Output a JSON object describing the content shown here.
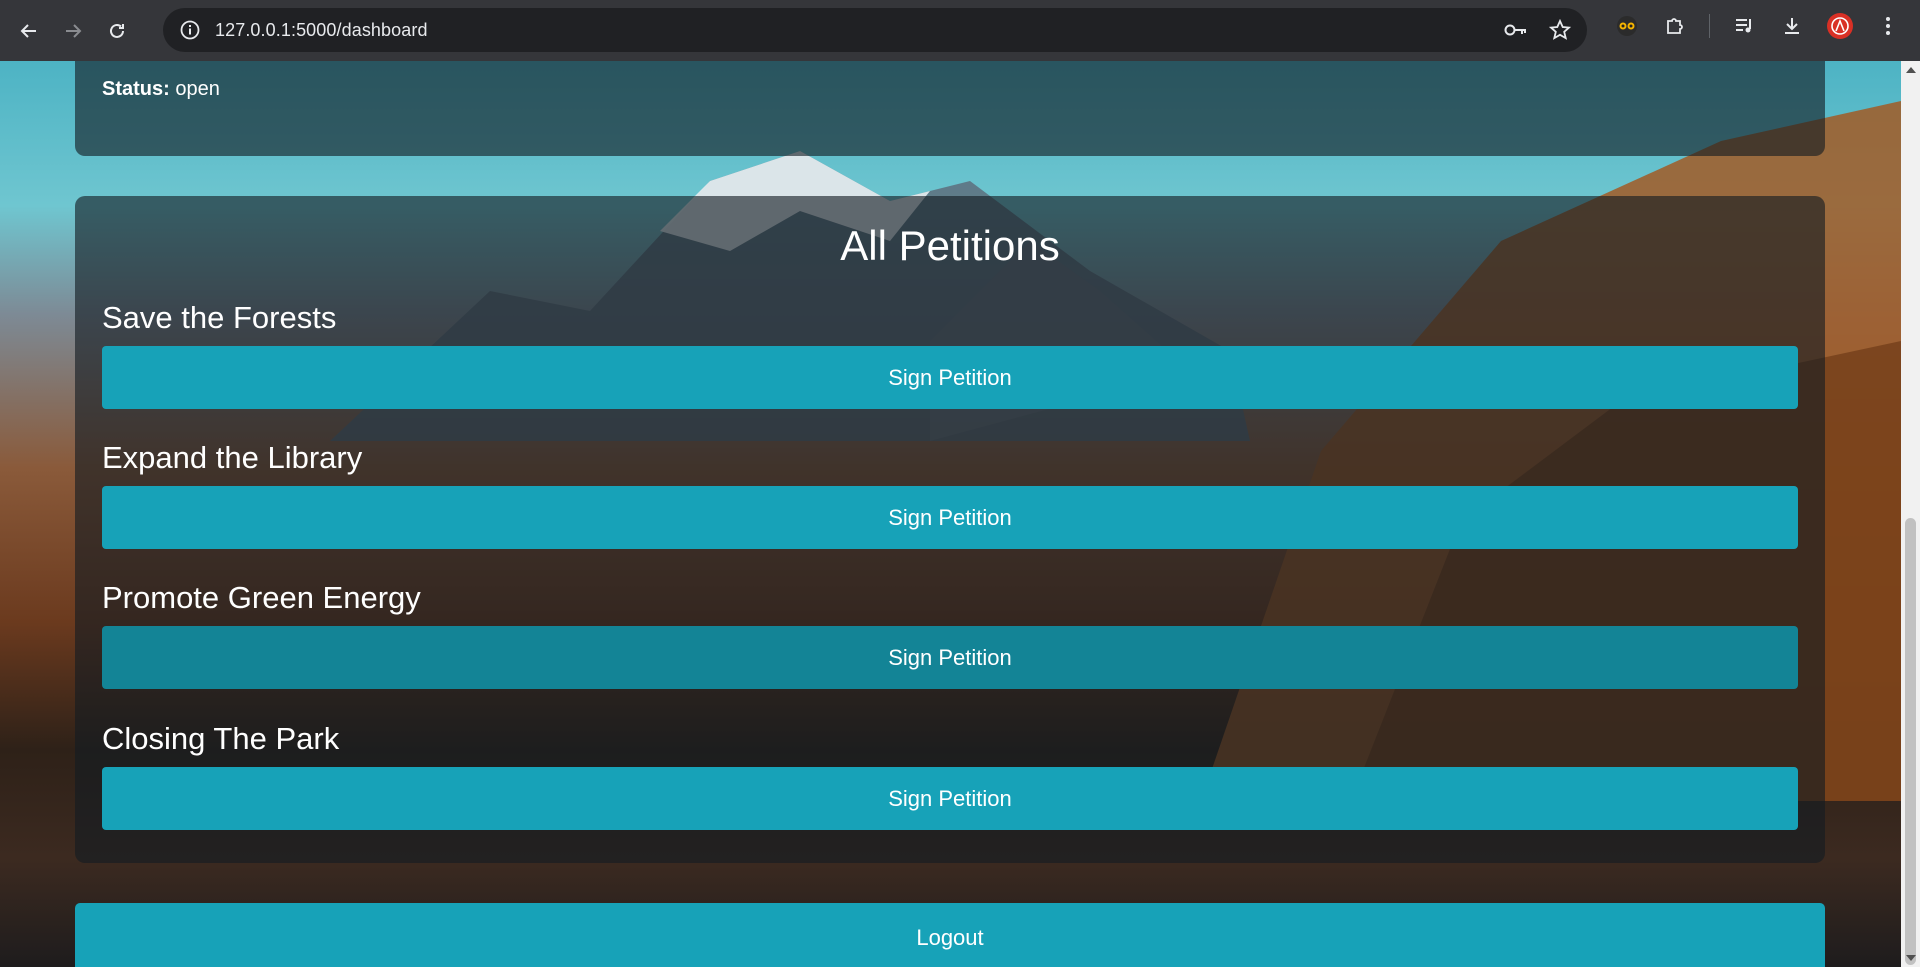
{
  "browser": {
    "url": "127.0.0.1:5000/dashboard",
    "icons": [
      "back-icon",
      "forward-icon",
      "reload-icon",
      "site-info-icon",
      "key-icon",
      "star-icon",
      "extension-glasses-icon",
      "extensions-icon",
      "media-control-icon",
      "download-icon",
      "profile-avatar-icon",
      "menu-icon"
    ]
  },
  "status": {
    "label": "Status:",
    "value": "open"
  },
  "petitions": {
    "heading": "All Petitions",
    "items": [
      {
        "title": "Save the Forests",
        "button": "Sign Petition"
      },
      {
        "title": "Expand the Library",
        "button": "Sign Petition"
      },
      {
        "title": "Promote Green Energy",
        "button": "Sign Petition"
      },
      {
        "title": "Closing The Park",
        "button": "Sign Petition"
      }
    ]
  },
  "logout_label": "Logout",
  "colors": {
    "button": "#17a2b8",
    "button_hover": "#138496",
    "card": "rgba(20,28,34,0.62)"
  }
}
